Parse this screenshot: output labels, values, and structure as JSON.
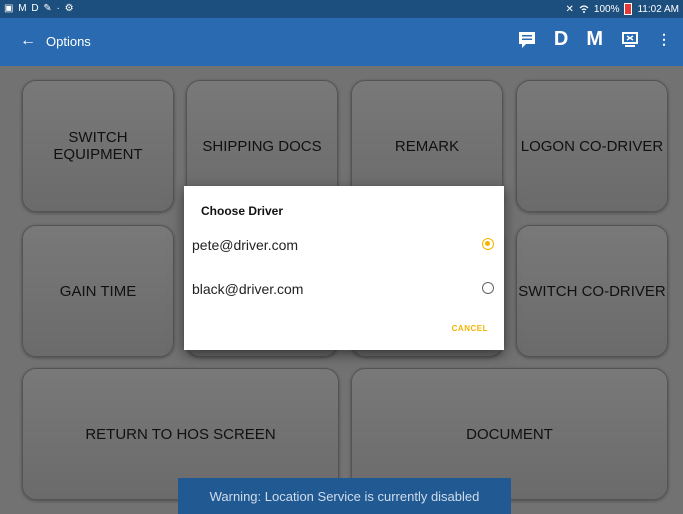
{
  "statusbar": {
    "left_text": "▣ M D ✎ · ⚙",
    "mute_icon": "🔇",
    "wifi_icon": "wifi",
    "battery_text": "100%",
    "time": "11:02 AM"
  },
  "appbar": {
    "back_glyph": "←",
    "title": "Options",
    "action_d": "D",
    "action_m": "M"
  },
  "buttons": {
    "switch_equipment": "SWITCH EQUIPMENT",
    "shipping_docs": "SHIPPING DOCS",
    "remark": "REMARK",
    "logon_co_driver": "LOGON CO-DRIVER",
    "gain_time": "GAIN TIME",
    "switch_co_driver": "SWITCH CO-DRIVER",
    "return_to_hos": "RETURN TO HOS SCREEN",
    "document": "DOCUMENT"
  },
  "dialog": {
    "title": "Choose Driver",
    "options": [
      {
        "label": "pete@driver.com",
        "selected": true
      },
      {
        "label": "black@driver.com",
        "selected": false
      }
    ],
    "cancel_label": "CANCEL",
    "accent": "#f5b400"
  },
  "toast": {
    "text": "Warning: Location Service is currently disabled"
  },
  "colors": {
    "appbar": "#2a6ab0",
    "statusbar": "#1d4f7e"
  }
}
